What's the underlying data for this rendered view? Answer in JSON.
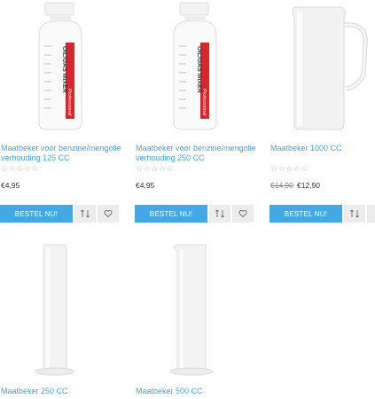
{
  "products": [
    {
      "title": "Maatbeker voor benzine/mengolie verhouding 125 CC",
      "price": "€4,95",
      "image": "oil-mix-bottle-125",
      "label_text": "OIL/GAS MIXER Professional"
    },
    {
      "title": "Maatbeker voor benzine/mengolie verhouding 250 CC",
      "price": "€4,95",
      "image": "oil-mix-bottle-250",
      "label_text": "OIL/GAS MIXER Professional"
    },
    {
      "title": "Maatbeker 1000 CC",
      "old_price": "€14,90",
      "price": "€12,90",
      "image": "measuring-jug-1000"
    },
    {
      "title": "Maatbeker 250 CC",
      "image": "measuring-cylinder-250"
    },
    {
      "title": "Maatbeker 500 CC",
      "image": "measuring-cylinder-500"
    }
  ],
  "buy_label": "BESTEL NU!",
  "rating_stars": "☆☆☆☆☆",
  "icons": {
    "compare": "compare-icon",
    "wishlist": "heart-icon"
  },
  "colors": {
    "accent": "#43a8e4",
    "link": "#3fa9e1",
    "icon_bg": "#ececec"
  }
}
